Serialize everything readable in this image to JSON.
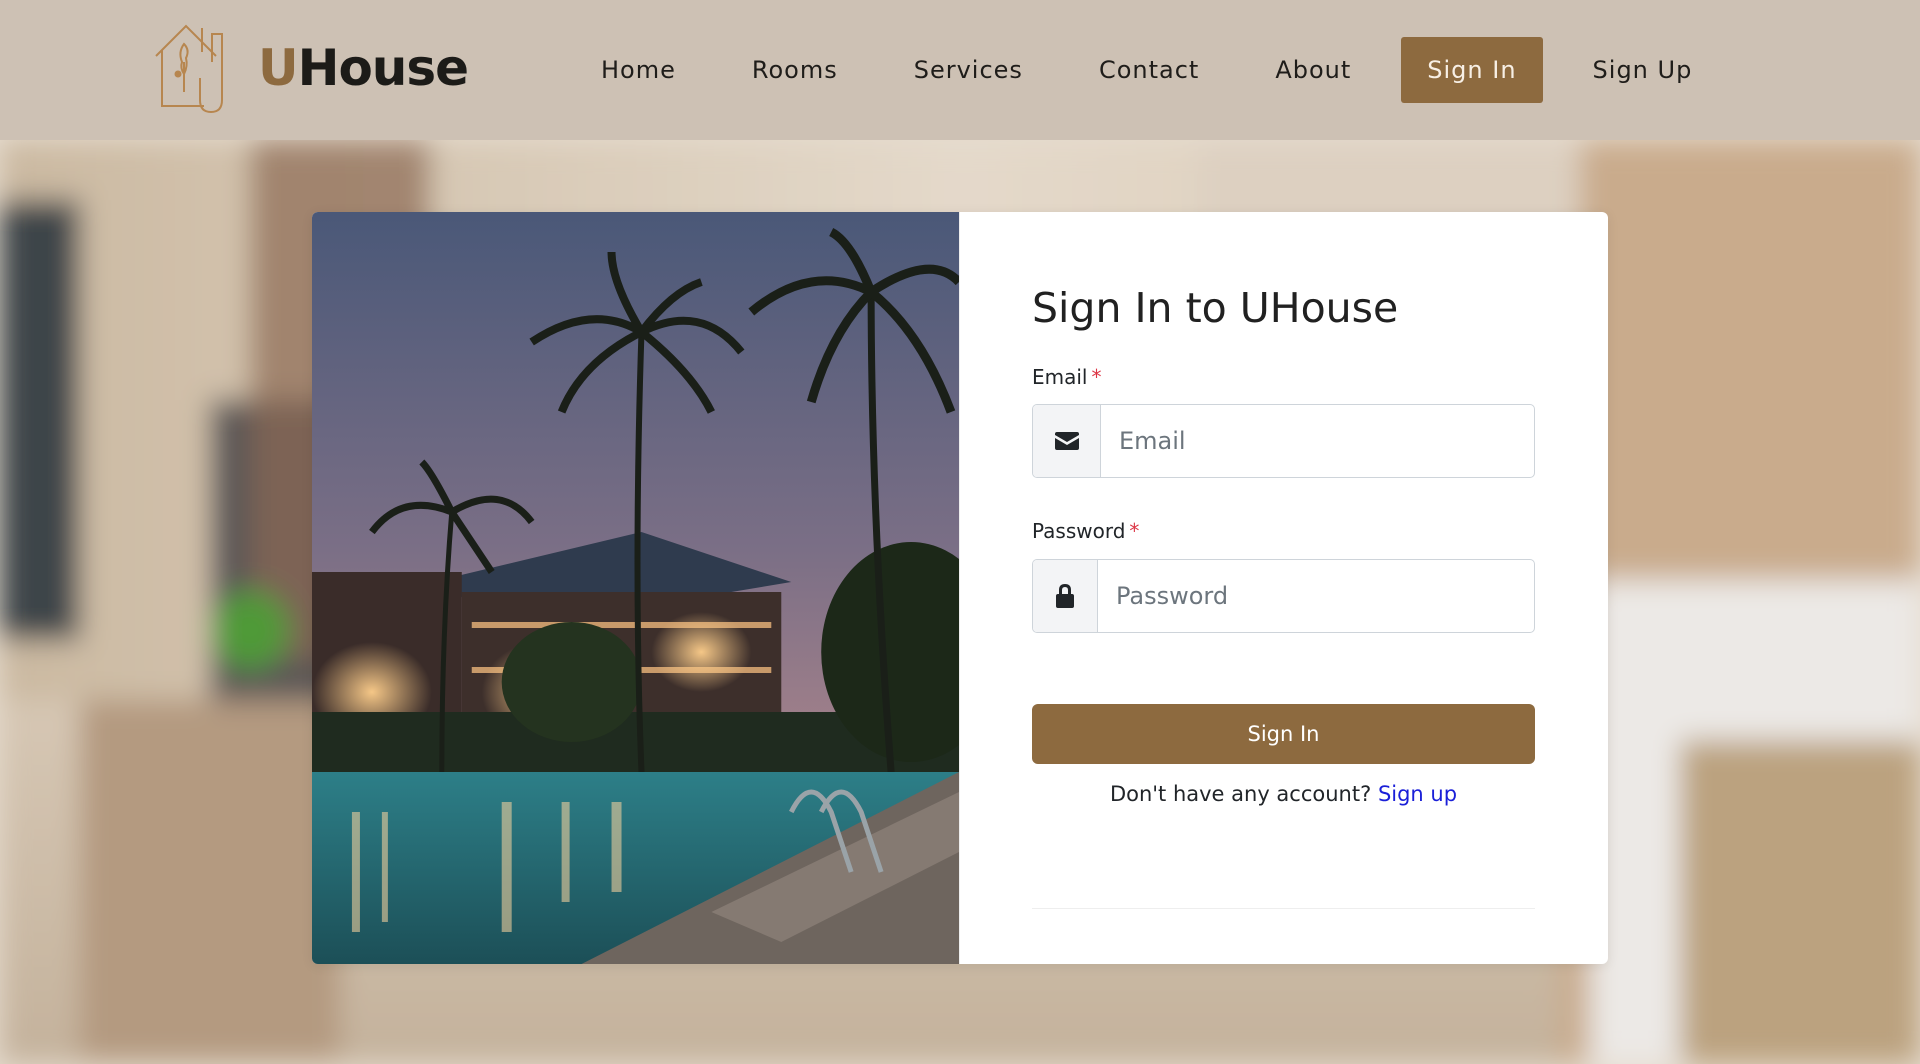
{
  "brand": {
    "name_initial": "U",
    "name_rest": "House",
    "logo_icon": "house-logo-icon"
  },
  "nav": {
    "items": [
      {
        "label": "Home"
      },
      {
        "label": "Rooms"
      },
      {
        "label": "Services"
      },
      {
        "label": "Contact"
      },
      {
        "label": "About"
      },
      {
        "label": "Sign In",
        "active": true
      },
      {
        "label": "Sign Up"
      }
    ]
  },
  "form": {
    "title": "Sign In to UHouse",
    "email": {
      "label": "Email",
      "required_mark": "*",
      "placeholder": "Email",
      "icon": "envelope-icon"
    },
    "password": {
      "label": "Password",
      "required_mark": "*",
      "placeholder": "Password",
      "icon": "lock-icon"
    },
    "submit_label": "Sign In",
    "footer": {
      "prompt": "Don't have any account?",
      "link": "Sign up"
    }
  },
  "colors": {
    "header_bg": "#cdc1b4",
    "accent": "#8d6a3f",
    "link": "#1a1fd8",
    "required": "#dc3545"
  }
}
